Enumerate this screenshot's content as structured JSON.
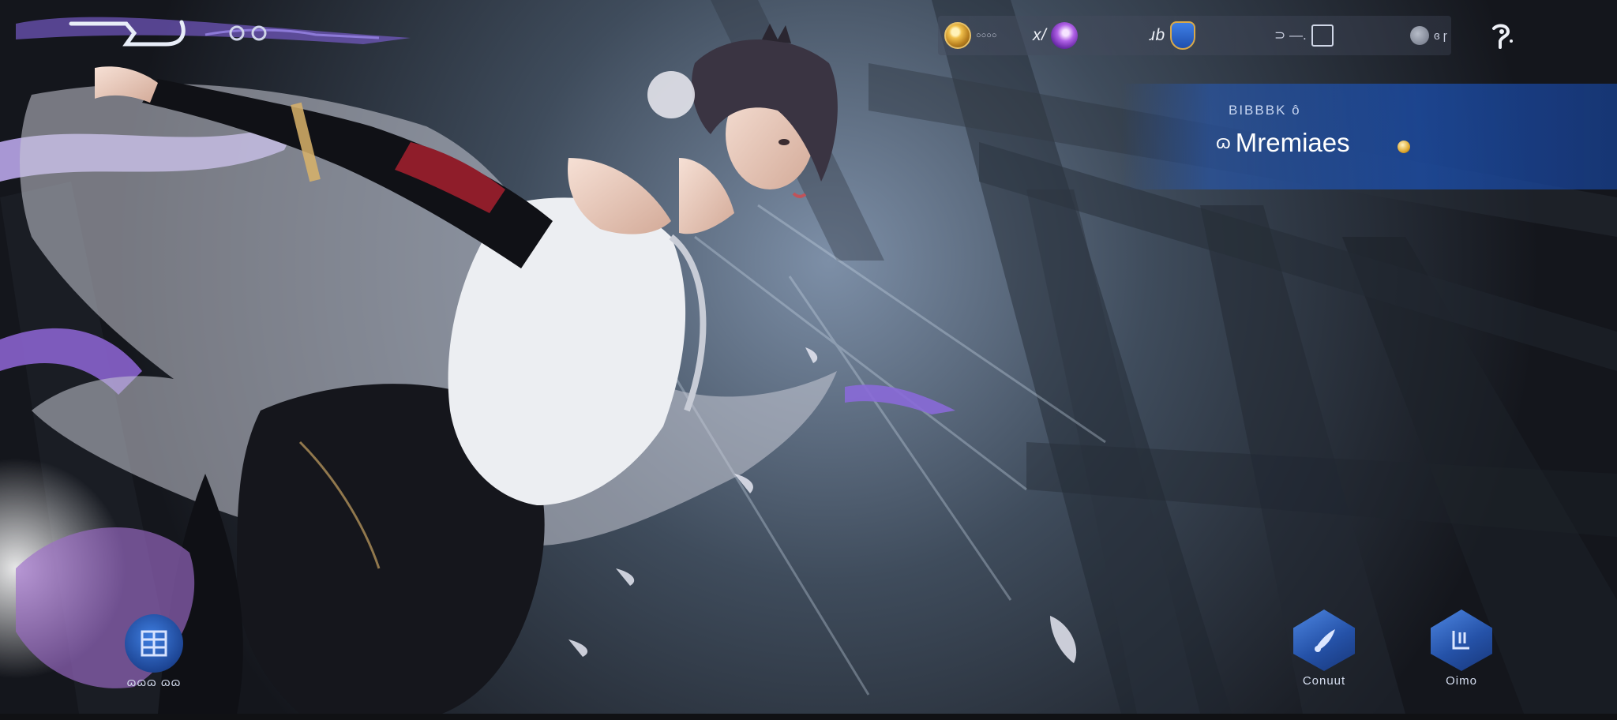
{
  "top_left": {
    "logo_icon": "game-logo-glyph"
  },
  "top_bar": {
    "items": [
      {
        "icon": "gold-coin-icon",
        "value": "○○○○",
        "color": "#e6c068"
      },
      {
        "icon": "purple-gem-icon",
        "value": "x/",
        "color": "#b061e6"
      },
      {
        "icon": "shield-crest-icon",
        "value": "ɹb",
        "color": "#3f7fe6"
      },
      {
        "icon": "card-icon",
        "value": "⊃ —."
      },
      {
        "icon": "gray-token-icon",
        "value": "ɞ ɼ"
      }
    ],
    "settings_icon": "gear-icon"
  },
  "banner": {
    "subtitle": "BIBBBK ô",
    "leading_glyph": "ɷ",
    "name": "Mremiaes",
    "accent_color": "#2a5fbf"
  },
  "bottom_left": {
    "label": "ɷɷɷ ɷɷ",
    "icon": "menu-grid-icon"
  },
  "bottom_right": [
    {
      "label": "Conuut",
      "icon": "quill-icon"
    },
    {
      "label": "Oimo",
      "icon": "bracket-icon"
    }
  ]
}
